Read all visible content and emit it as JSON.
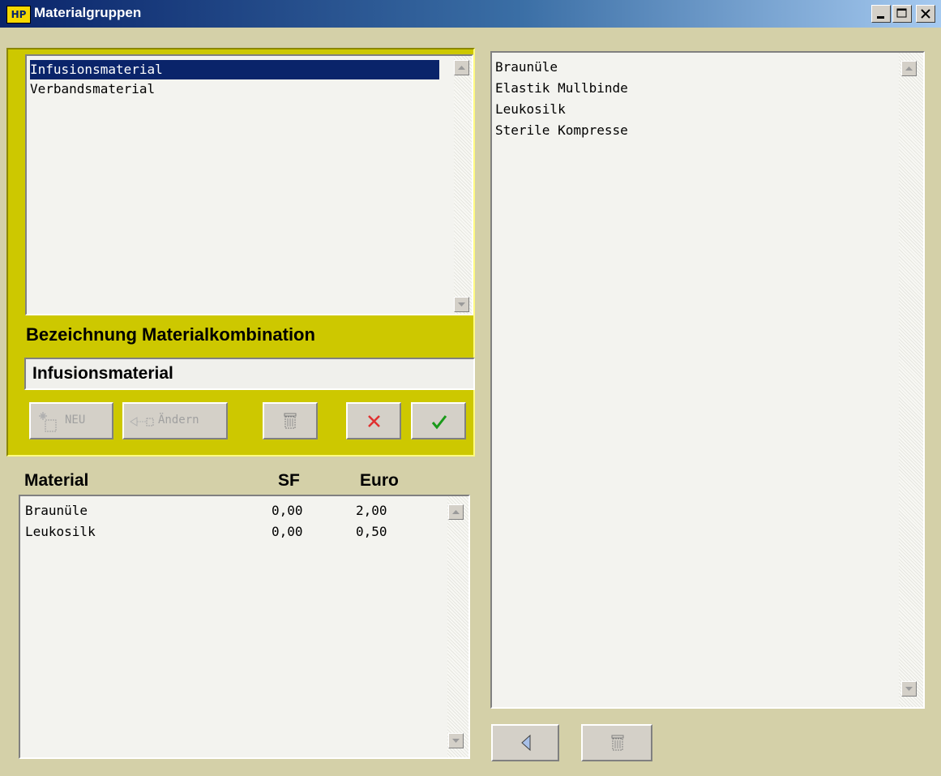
{
  "window": {
    "app_badge": "HP",
    "title": "Materialgruppen"
  },
  "groups": {
    "items": [
      "Infusionsmaterial",
      "Verbandsmaterial"
    ],
    "selected_index": 0
  },
  "combination": {
    "label": "Bezeichnung Materialkombination",
    "value": "Infusionsmaterial"
  },
  "buttons": {
    "new_label": "NEU",
    "edit_label": "Ändern"
  },
  "material_table": {
    "headers": [
      "Material",
      "SF",
      "Euro"
    ],
    "rows": [
      [
        "Braunüle",
        "0,00",
        "2,00"
      ],
      [
        "Leukosilk",
        "0,00",
        "0,50"
      ]
    ]
  },
  "available_materials": [
    "Braunüle",
    "Elastik Mullbinde",
    "Leukosilk",
    "Sterile Kompresse"
  ],
  "icons": {
    "new": "new-document-icon",
    "edit": "edit-icon",
    "delete": "trash-icon",
    "cancel": "x-cancel-icon",
    "confirm": "checkmark-icon",
    "add": "arrow-left-icon"
  },
  "colors": {
    "panel": "#cdc800",
    "selection": "#0a246a",
    "cancel": "#e03030",
    "confirm": "#1a9a1a"
  }
}
